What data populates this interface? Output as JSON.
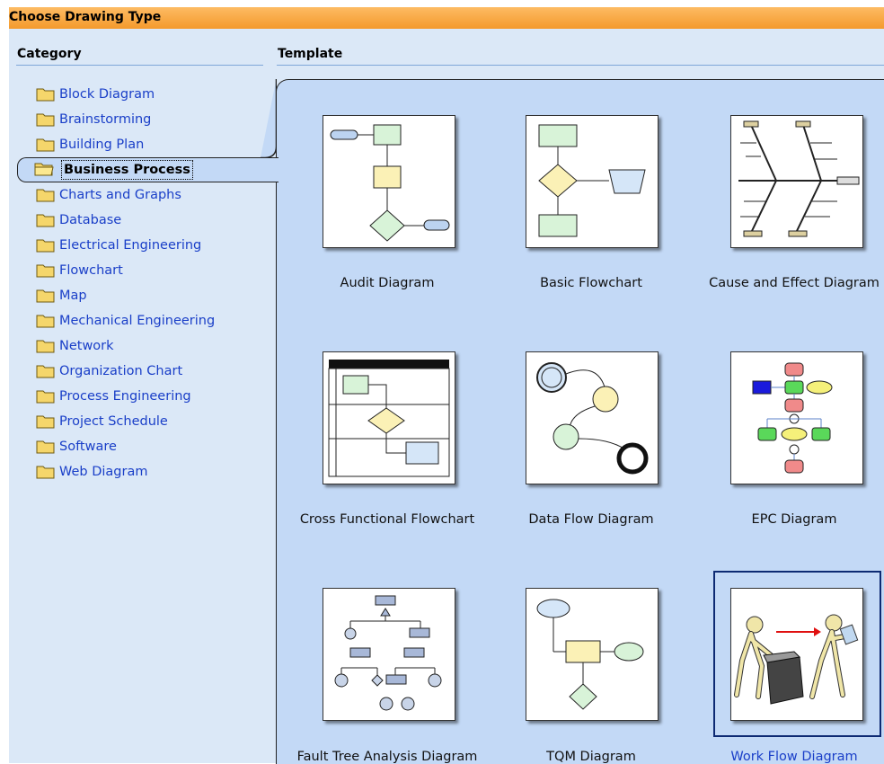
{
  "dialog": {
    "title": "Choose Drawing Type"
  },
  "category": {
    "header": "Category",
    "items": [
      {
        "label": "Block Diagram"
      },
      {
        "label": "Brainstorming"
      },
      {
        "label": "Building Plan"
      },
      {
        "label": "Business Process"
      },
      {
        "label": "Charts and Graphs"
      },
      {
        "label": "Database"
      },
      {
        "label": "Electrical Engineering"
      },
      {
        "label": "Flowchart"
      },
      {
        "label": "Map"
      },
      {
        "label": "Mechanical Engineering"
      },
      {
        "label": "Network"
      },
      {
        "label": "Organization Chart"
      },
      {
        "label": "Process Engineering"
      },
      {
        "label": "Project Schedule"
      },
      {
        "label": "Software"
      },
      {
        "label": "Web Diagram"
      }
    ],
    "selected": "Business Process"
  },
  "template": {
    "header": "Template",
    "items": [
      {
        "label": "Audit Diagram",
        "icon": "audit-diagram-thumbnail"
      },
      {
        "label": "Basic Flowchart",
        "icon": "basic-flowchart-thumbnail"
      },
      {
        "label": "Cause and Effect Diagram",
        "icon": "cause-effect-thumbnail"
      },
      {
        "label": "Cross Functional Flowchart",
        "icon": "cross-functional-thumbnail"
      },
      {
        "label": "Data Flow Diagram",
        "icon": "data-flow-thumbnail"
      },
      {
        "label": "EPC Diagram",
        "icon": "epc-thumbnail"
      },
      {
        "label": "Fault Tree Analysis Diagram",
        "icon": "fault-tree-thumbnail"
      },
      {
        "label": "TQM Diagram",
        "icon": "tqm-thumbnail"
      },
      {
        "label": "Work Flow Diagram",
        "icon": "work-flow-thumbnail"
      }
    ],
    "selected": "Work Flow Diagram"
  },
  "colors": {
    "title_bar": "#f49a2c",
    "panel": "#dbe8f7",
    "content": "#c3d9f6",
    "link": "#1a3fc8",
    "selection": "#0d2a73"
  }
}
